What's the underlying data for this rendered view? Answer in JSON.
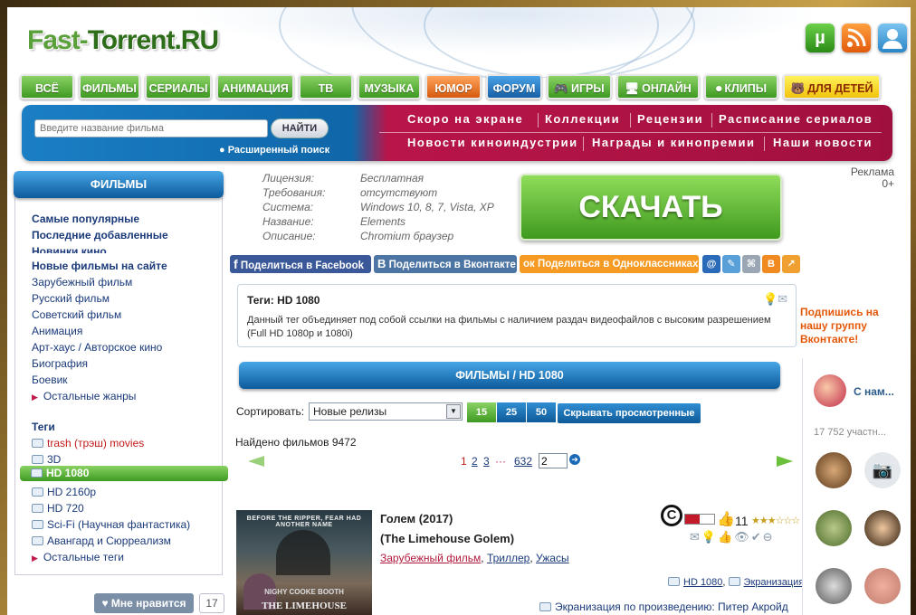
{
  "header": {
    "logo_part1": "Fast-",
    "logo_part2": "Torrent.RU"
  },
  "nav": [
    {
      "label": "ВСЁ",
      "style": "green"
    },
    {
      "label": "ФИЛЬМЫ",
      "style": "green"
    },
    {
      "label": "СЕРИАЛЫ",
      "style": "green"
    },
    {
      "label": "АНИМАЦИЯ",
      "style": "green"
    },
    {
      "label": "ТВ",
      "style": "green"
    },
    {
      "label": "МУЗЫКА",
      "style": "green"
    },
    {
      "label": "ЮМОР",
      "style": "orange"
    },
    {
      "label": "ФОРУМ",
      "style": "blue"
    },
    {
      "label": "ИГРЫ",
      "style": "green",
      "icon": "gamepad-icon"
    },
    {
      "label": "ОНЛАЙН",
      "style": "green",
      "icon": "monitor-icon"
    },
    {
      "label": "КЛИПЫ",
      "style": "green",
      "icon": "record-icon"
    },
    {
      "label": "ДЛЯ ДЕТЕЙ",
      "style": "yellow",
      "icon": "bear-icon"
    }
  ],
  "search": {
    "placeholder": "Введите название фильма",
    "button": "НАЙТИ",
    "advanced": "● Расширенный поиск"
  },
  "top_links": {
    "row1": [
      "Скоро на экране",
      "Коллекции",
      "Рецензии",
      "Расписание сериалов"
    ],
    "row2": [
      "Новости киноиндустрии",
      "Награды и кинопремии",
      "Наши новости"
    ]
  },
  "sidebar": {
    "title": "ФИЛЬМЫ",
    "main": [
      "Самые популярные",
      "Последние добавленные",
      "Новинки кино",
      "Новые фильмы на сайте"
    ],
    "genres": [
      "Зарубежный фильм",
      "Русский фильм",
      "Советский фильм",
      "Анимация",
      "Арт-хаус / Авторское кино",
      "Биография",
      "Боевик"
    ],
    "more_genres": "Остальные жанры",
    "tags_title": "Теги",
    "tags": [
      "trash (трэш) movies",
      "3D",
      "HD 1080",
      "HD 2160p",
      "HD 720",
      "Sci-Fi (Научная фантастика)",
      "Авангард и Сюрреализм"
    ],
    "more_tags": "Остальные теги",
    "like": "Мне нравится",
    "like_count": "17"
  },
  "info": {
    "labels": [
      "Лицензия:",
      "Требования:",
      "Система:",
      "Название:",
      "Описание:"
    ],
    "values": [
      "Бесплатная",
      "отсутствуют",
      "Windows 10, 8, 7, Vista, XP",
      "Elements",
      "Chromium браузер"
    ]
  },
  "download": "СКАЧАТЬ",
  "ad": "Реклама\n0+",
  "share": {
    "facebook": "Поделиться в Facebook",
    "vk": "Поделиться в Вконтакте",
    "ok": "Поделиться в Одноклассниках"
  },
  "tagbox": {
    "title": "Теги: HD 1080",
    "text": "Данный тег объединяет под собой ссылки на фильмы с наличием раздач видеофайлов с высоким разрешением (Full HD 1080p и 1080i)"
  },
  "vk_invite": "Подпишись на нашу группу Вконтакте!",
  "films_bar": "ФИЛЬМЫ / HD 1080",
  "sort": {
    "label": "Сортировать:",
    "selected": "Новые релизы",
    "per_page": [
      "15",
      "25",
      "50"
    ],
    "hide": "Скрывать просмотренные"
  },
  "found": "Найдено фильмов 9472",
  "pagination": {
    "pages": [
      "1",
      "2",
      "3"
    ],
    "dots": "···",
    "last": "632",
    "input": "2"
  },
  "film": {
    "title": "Голем (2017)",
    "orig": "(The Limehouse Golem)",
    "genres": [
      "Зарубежный фильм",
      "Триллер",
      "Ужасы"
    ],
    "rating": "11",
    "tags": [
      "HD 1080",
      "Экранизация"
    ],
    "adaptation_label": "Экранизация по произведению:",
    "adaptation_author": "Питер Акройд",
    "poster_top": "BEFORE THE RIPPER, FEAR HAD ANOTHER NAME",
    "poster_names": "NIGHY   COOKE   BOOTH",
    "poster_title": "THE LIMEHOUSE"
  },
  "vk_group": {
    "name": "С нам...",
    "members": "17 752 участн..."
  }
}
